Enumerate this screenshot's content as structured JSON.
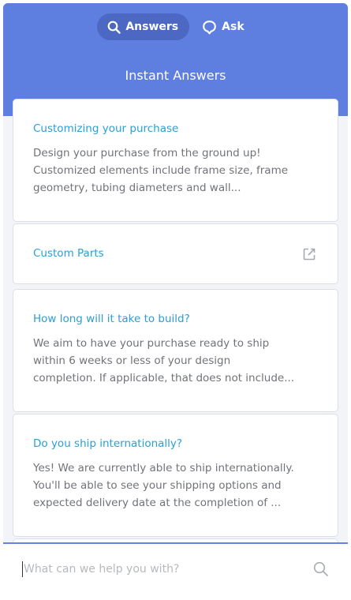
{
  "header": {
    "tabs": [
      {
        "label": "Answers",
        "icon": "search-icon",
        "active": true
      },
      {
        "label": "Ask",
        "icon": "chat-bubble-icon",
        "active": false
      }
    ],
    "title": "Instant Answers"
  },
  "articles": [
    {
      "title": "Customizing your purchase",
      "excerpt": "Design your purchase from the ground up!\nCustomized elements include frame size, frame\ngeometry, tubing diameters and wall..."
    },
    {
      "title": "Custom Parts",
      "icon": "external-link-icon"
    },
    {
      "title": "How long will it take to build?",
      "excerpt": "We aim to have your purchase ready to ship\nwithin 6 weeks or less of your design\ncompletion. If applicable, that does not include..."
    },
    {
      "title": "Do you ship internationally?",
      "excerpt": "Yes! We are currently able to ship internationally.\nYou'll be able to see your shipping options and\nexpected delivery date at the completion of ..."
    }
  ],
  "search": {
    "value": "",
    "placeholder": "What can we help you with?",
    "icon": "search-icon"
  },
  "colors": {
    "header": "#5e7ee0",
    "active_tab": "#4c68c2",
    "link": "#2b9ed8",
    "body_text": "#707378",
    "background": "#f3f4f7"
  }
}
